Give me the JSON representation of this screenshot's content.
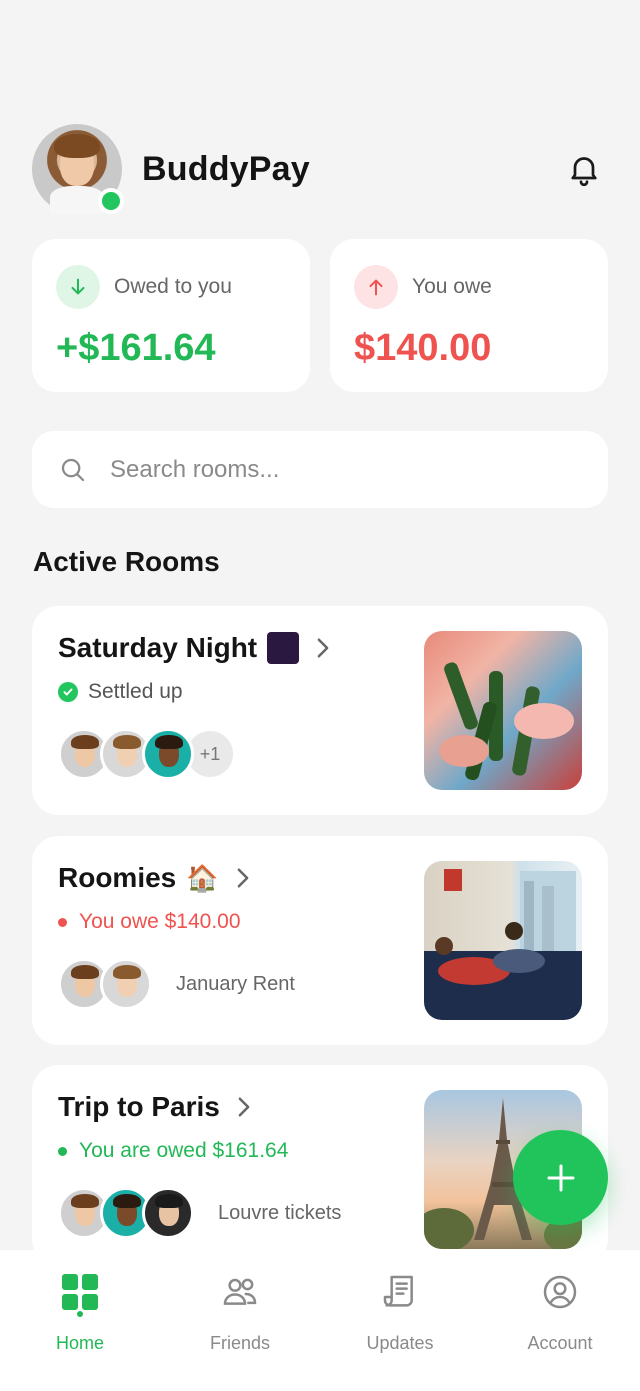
{
  "app": {
    "title": "BuddyPay"
  },
  "balances": {
    "owed_to_you": {
      "label": "Owed to you",
      "amount": "+$161.64",
      "color": "#22b856"
    },
    "you_owe": {
      "label": "You owe",
      "amount": "$140.00",
      "color": "#ef5350"
    }
  },
  "search": {
    "placeholder": "Search rooms..."
  },
  "section": {
    "title": "Active Rooms"
  },
  "rooms": [
    {
      "title": "Saturday Night",
      "emoji": "🎆",
      "status": "Settled up",
      "status_type": "settled",
      "extra_members": "+1",
      "note": "",
      "thumb": "beer-toast-photo"
    },
    {
      "title": "Roomies",
      "emoji": "🏠",
      "status": "You owe $140.00",
      "status_type": "owe",
      "note": "January Rent",
      "thumb": "apartment-photo"
    },
    {
      "title": "Trip to Paris",
      "emoji": "",
      "status": "You are owed $161.64",
      "status_type": "owed",
      "note": "Louvre tickets",
      "thumb": "eiffel-tower-photo"
    }
  ],
  "tabs": [
    {
      "label": "Home",
      "icon": "grid-icon",
      "active": true
    },
    {
      "label": "Friends",
      "icon": "people-icon",
      "active": false
    },
    {
      "label": "Updates",
      "icon": "receipt-icon",
      "active": false
    },
    {
      "label": "Account",
      "icon": "user-circle-icon",
      "active": false
    }
  ],
  "colors": {
    "accent": "#22c55e",
    "danger": "#ef5350",
    "background": "#f4f4f4"
  }
}
